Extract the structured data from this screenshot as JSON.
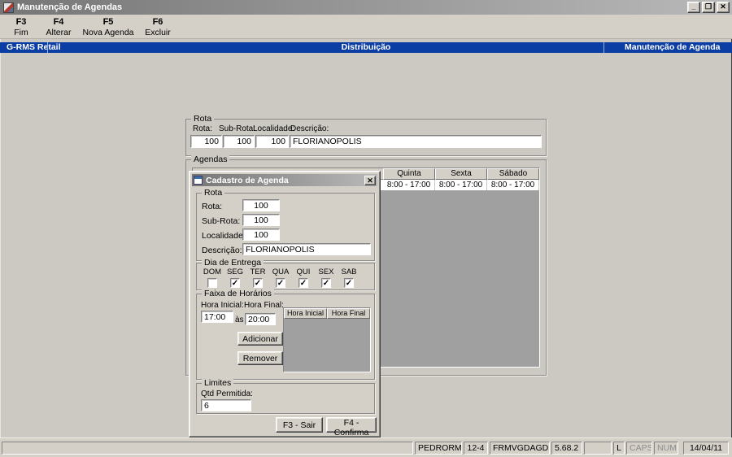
{
  "window": {
    "title": "Manutenção de Agendas",
    "minimize": "_",
    "maximize": "❐",
    "close": "✕"
  },
  "toolbar": {
    "buttons": [
      {
        "key": "F3",
        "label": "Fim"
      },
      {
        "key": "F4",
        "label": "Alterar"
      },
      {
        "key": "F5",
        "label": "Nova Agenda"
      },
      {
        "key": "F6",
        "label": "Excluir"
      }
    ]
  },
  "header": {
    "brand": "G-RMS Retail",
    "module": "Distribuição",
    "screen": "Manutenção de Agenda",
    "accent_color": "#0b3ea5"
  },
  "rota_panel": {
    "title": "Rota",
    "rota_label": "Rota:",
    "rota_value": "100",
    "subrota_label": "Sub-Rota:",
    "subrota_value": "100",
    "localidade_label": "Localidade:",
    "localidade_value": "100",
    "descricao_label": "Descrição:",
    "descricao_value": "FLORIANOPOLIS"
  },
  "agendas_panel": {
    "title": "Agendas",
    "grid": {
      "columns": [
        "Quinta",
        "Sexta",
        "Sábado"
      ],
      "row": [
        "8:00 - 17:00",
        "8:00 - 17:00",
        "8:00 - 17:00"
      ]
    }
  },
  "dialog": {
    "title": "Cadastro de Agenda",
    "close": "✕",
    "rota_group": {
      "title": "Rota",
      "rota_label": "Rota:",
      "rota_value": "100",
      "subrota_label": "Sub-Rota:",
      "subrota_value": "100",
      "localidade_label": "Localidade:",
      "localidade_value": "100",
      "descricao_label": "Descrição:",
      "descricao_value": "FLORIANOPOLIS"
    },
    "dias_group": {
      "title": "Dia de Entrega",
      "days": [
        {
          "label": "DOM",
          "mark": ""
        },
        {
          "label": "SEG",
          "mark": "✓"
        },
        {
          "label": "TER",
          "mark": "✓"
        },
        {
          "label": "QUA",
          "mark": "✓"
        },
        {
          "label": "QUI",
          "mark": "✓"
        },
        {
          "label": "SEX",
          "mark": "✓"
        },
        {
          "label": "SAB",
          "mark": "✓"
        }
      ]
    },
    "faixa_group": {
      "title": "Faixa de Horários",
      "hora_inicial_label": "Hora Inicial:",
      "hora_final_label": "Hora Final:",
      "hora_inicial_value": "17:00",
      "conj_label": "às",
      "hora_final_value": "20:00",
      "adicionar_label": "Adicionar",
      "remover_label": "Remover",
      "list_columns": [
        "Hora Inicial",
        "Hora Final"
      ]
    },
    "limites_group": {
      "title": "Limites",
      "qtd_label": "Qtd Permitida:",
      "qtd_value": "6"
    },
    "sair_label": "F3 - Sair",
    "confirma_label": "F4 - Confirma"
  },
  "statusbar": {
    "user": "PEDRORMS",
    "position": "12-4",
    "form": "FRMVGDAGDRT",
    "version": "5.68.2",
    "indicator_l": "L",
    "indicator_caps": "CAPS",
    "indicator_num": "NUM",
    "date": "14/04/11"
  }
}
